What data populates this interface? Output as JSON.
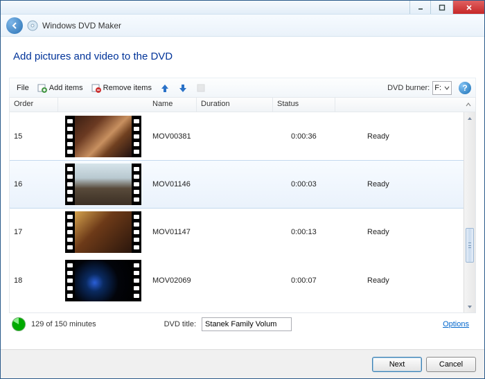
{
  "app": {
    "title": "Windows DVD Maker"
  },
  "heading": "Add pictures and video to the DVD",
  "toolbar": {
    "file": "File",
    "add_items": "Add items",
    "remove_items": "Remove items",
    "burner_label": "DVD burner:",
    "burner_value": "F:"
  },
  "columns": {
    "order": "Order",
    "name": "Name",
    "duration": "Duration",
    "status": "Status"
  },
  "rows": [
    {
      "order": "15",
      "name": "MOV00381",
      "duration": "0:00:36",
      "status": "Ready",
      "selected": false,
      "thumb": "linear-gradient(135deg,#3a1e12 0%,#6b3a22 30%,#c89060 55%,#704020 70%,#201010 100%)"
    },
    {
      "order": "16",
      "name": "MOV01146",
      "duration": "0:00:03",
      "status": "Ready",
      "selected": true,
      "thumb": "linear-gradient(180deg,#d6e4ea 0%,#b8c8cf 35%,#584a3a 60%,#3b2f24 100%)"
    },
    {
      "order": "17",
      "name": "MOV01147",
      "duration": "0:00:13",
      "status": "Ready",
      "selected": false,
      "thumb": "linear-gradient(135deg,#d4a24e 0%,#6d3a18 40%,#2a160c 100%)"
    },
    {
      "order": "18",
      "name": "MOV02069",
      "duration": "0:00:07",
      "status": "Ready",
      "selected": false,
      "thumb": "radial-gradient(circle at 35% 55%, #2a5fd8 0%, #0a2a60 20%, #02040a 55%, #000 100%)"
    }
  ],
  "footer": {
    "minutes": "129 of 150 minutes",
    "dvd_title_label": "DVD title:",
    "dvd_title_value": "Stanek Family Volum",
    "options": "Options"
  },
  "buttons": {
    "next": "Next",
    "cancel": "Cancel"
  }
}
